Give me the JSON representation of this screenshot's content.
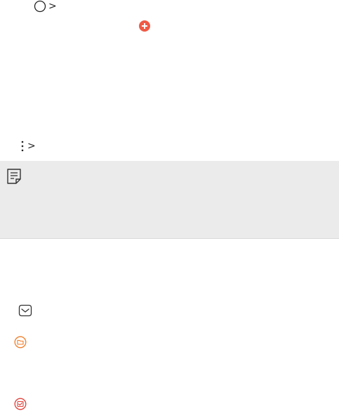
{
  "icons": {
    "home": "home-circle-icon",
    "add": "plus-icon",
    "more": "more-vertical-icon",
    "note": "note-icon",
    "mail": "envelope-icon",
    "folder": "folder-icon",
    "mail_check": "mail-check-icon"
  },
  "glyphs": {
    "chevron": ">"
  },
  "colors": {
    "accent_red": "#ef5a47",
    "accent_orange": "#f07e2a",
    "note_background": "#ebebeb",
    "icon_dark": "#333333"
  }
}
